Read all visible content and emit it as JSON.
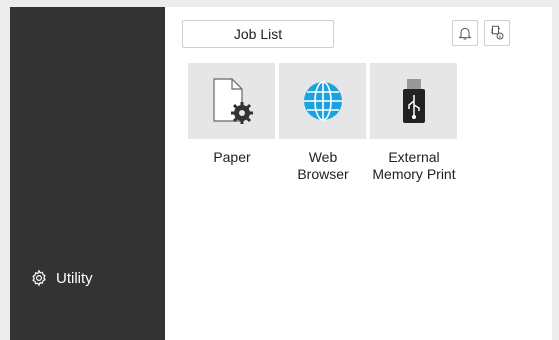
{
  "sidebar": {
    "utility_label": "Utility"
  },
  "header": {
    "job_list_label": "Job List"
  },
  "tiles": [
    {
      "label": "Paper",
      "icon": "paper-gear-icon"
    },
    {
      "label": "Web\nBrowser",
      "icon": "globe-icon"
    },
    {
      "label": "External\nMemory Print",
      "icon": "usb-icon"
    }
  ],
  "colors": {
    "sidebar_bg": "#333333",
    "tile_bg": "#e6e6e6",
    "globe": "#1aa3df"
  }
}
